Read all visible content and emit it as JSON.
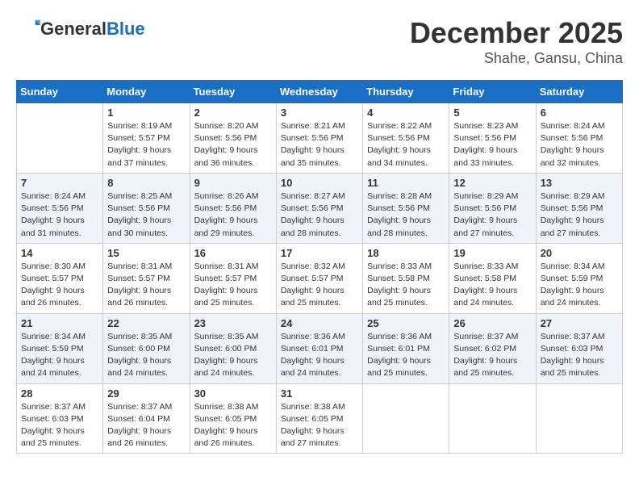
{
  "header": {
    "logo_line1": "General",
    "logo_line2": "Blue",
    "month": "December 2025",
    "location": "Shahe, Gansu, China"
  },
  "weekdays": [
    "Sunday",
    "Monday",
    "Tuesday",
    "Wednesday",
    "Thursday",
    "Friday",
    "Saturday"
  ],
  "weeks": [
    [
      {
        "num": "",
        "info": ""
      },
      {
        "num": "1",
        "info": "Sunrise: 8:19 AM\nSunset: 5:57 PM\nDaylight: 9 hours\nand 37 minutes."
      },
      {
        "num": "2",
        "info": "Sunrise: 8:20 AM\nSunset: 5:56 PM\nDaylight: 9 hours\nand 36 minutes."
      },
      {
        "num": "3",
        "info": "Sunrise: 8:21 AM\nSunset: 5:56 PM\nDaylight: 9 hours\nand 35 minutes."
      },
      {
        "num": "4",
        "info": "Sunrise: 8:22 AM\nSunset: 5:56 PM\nDaylight: 9 hours\nand 34 minutes."
      },
      {
        "num": "5",
        "info": "Sunrise: 8:23 AM\nSunset: 5:56 PM\nDaylight: 9 hours\nand 33 minutes."
      },
      {
        "num": "6",
        "info": "Sunrise: 8:24 AM\nSunset: 5:56 PM\nDaylight: 9 hours\nand 32 minutes."
      }
    ],
    [
      {
        "num": "7",
        "info": "Sunrise: 8:24 AM\nSunset: 5:56 PM\nDaylight: 9 hours\nand 31 minutes."
      },
      {
        "num": "8",
        "info": "Sunrise: 8:25 AM\nSunset: 5:56 PM\nDaylight: 9 hours\nand 30 minutes."
      },
      {
        "num": "9",
        "info": "Sunrise: 8:26 AM\nSunset: 5:56 PM\nDaylight: 9 hours\nand 29 minutes."
      },
      {
        "num": "10",
        "info": "Sunrise: 8:27 AM\nSunset: 5:56 PM\nDaylight: 9 hours\nand 28 minutes."
      },
      {
        "num": "11",
        "info": "Sunrise: 8:28 AM\nSunset: 5:56 PM\nDaylight: 9 hours\nand 28 minutes."
      },
      {
        "num": "12",
        "info": "Sunrise: 8:29 AM\nSunset: 5:56 PM\nDaylight: 9 hours\nand 27 minutes."
      },
      {
        "num": "13",
        "info": "Sunrise: 8:29 AM\nSunset: 5:56 PM\nDaylight: 9 hours\nand 27 minutes."
      }
    ],
    [
      {
        "num": "14",
        "info": "Sunrise: 8:30 AM\nSunset: 5:57 PM\nDaylight: 9 hours\nand 26 minutes."
      },
      {
        "num": "15",
        "info": "Sunrise: 8:31 AM\nSunset: 5:57 PM\nDaylight: 9 hours\nand 26 minutes."
      },
      {
        "num": "16",
        "info": "Sunrise: 8:31 AM\nSunset: 5:57 PM\nDaylight: 9 hours\nand 25 minutes."
      },
      {
        "num": "17",
        "info": "Sunrise: 8:32 AM\nSunset: 5:57 PM\nDaylight: 9 hours\nand 25 minutes."
      },
      {
        "num": "18",
        "info": "Sunrise: 8:33 AM\nSunset: 5:58 PM\nDaylight: 9 hours\nand 25 minutes."
      },
      {
        "num": "19",
        "info": "Sunrise: 8:33 AM\nSunset: 5:58 PM\nDaylight: 9 hours\nand 24 minutes."
      },
      {
        "num": "20",
        "info": "Sunrise: 8:34 AM\nSunset: 5:59 PM\nDaylight: 9 hours\nand 24 minutes."
      }
    ],
    [
      {
        "num": "21",
        "info": "Sunrise: 8:34 AM\nSunset: 5:59 PM\nDaylight: 9 hours\nand 24 minutes."
      },
      {
        "num": "22",
        "info": "Sunrise: 8:35 AM\nSunset: 6:00 PM\nDaylight: 9 hours\nand 24 minutes."
      },
      {
        "num": "23",
        "info": "Sunrise: 8:35 AM\nSunset: 6:00 PM\nDaylight: 9 hours\nand 24 minutes."
      },
      {
        "num": "24",
        "info": "Sunrise: 8:36 AM\nSunset: 6:01 PM\nDaylight: 9 hours\nand 24 minutes."
      },
      {
        "num": "25",
        "info": "Sunrise: 8:36 AM\nSunset: 6:01 PM\nDaylight: 9 hours\nand 25 minutes."
      },
      {
        "num": "26",
        "info": "Sunrise: 8:37 AM\nSunset: 6:02 PM\nDaylight: 9 hours\nand 25 minutes."
      },
      {
        "num": "27",
        "info": "Sunrise: 8:37 AM\nSunset: 6:03 PM\nDaylight: 9 hours\nand 25 minutes."
      }
    ],
    [
      {
        "num": "28",
        "info": "Sunrise: 8:37 AM\nSunset: 6:03 PM\nDaylight: 9 hours\nand 25 minutes."
      },
      {
        "num": "29",
        "info": "Sunrise: 8:37 AM\nSunset: 6:04 PM\nDaylight: 9 hours\nand 26 minutes."
      },
      {
        "num": "30",
        "info": "Sunrise: 8:38 AM\nSunset: 6:05 PM\nDaylight: 9 hours\nand 26 minutes."
      },
      {
        "num": "31",
        "info": "Sunrise: 8:38 AM\nSunset: 6:05 PM\nDaylight: 9 hours\nand 27 minutes."
      },
      {
        "num": "",
        "info": ""
      },
      {
        "num": "",
        "info": ""
      },
      {
        "num": "",
        "info": ""
      }
    ]
  ]
}
